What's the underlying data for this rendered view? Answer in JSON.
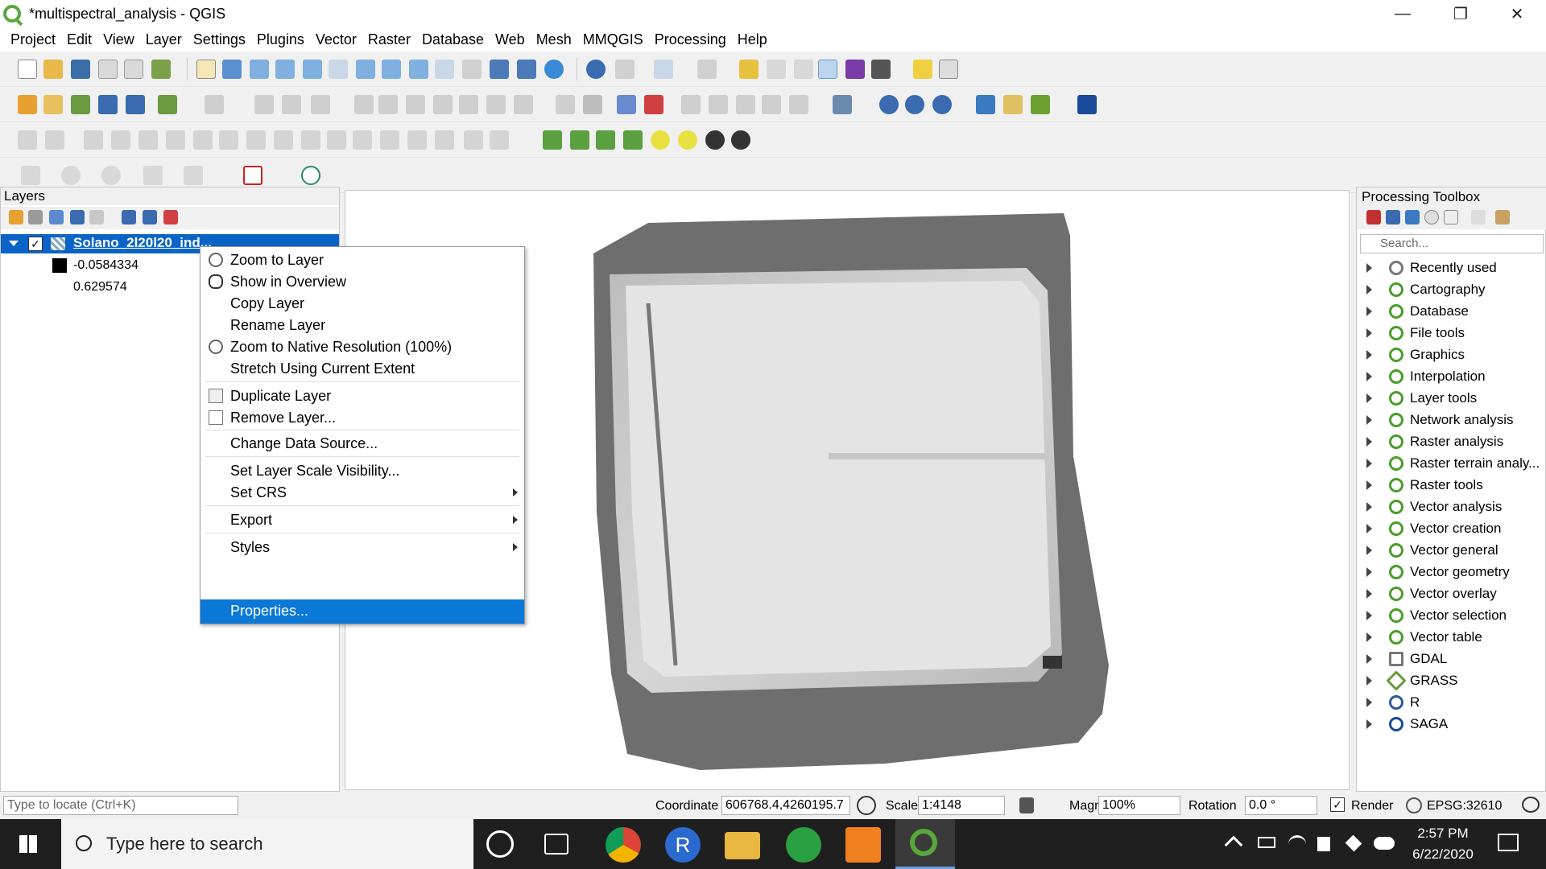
{
  "window": {
    "title": "*multispectral_analysis - QGIS"
  },
  "menubar": {
    "items": [
      "Project",
      "Edit",
      "View",
      "Layer",
      "Settings",
      "Plugins",
      "Vector",
      "Raster",
      "Database",
      "Web",
      "Mesh",
      "MMQGIS",
      "Processing",
      "Help"
    ]
  },
  "layers_panel": {
    "title": "Layers",
    "layer_name": "Solano_2l20l20_ind...",
    "legend_min": "-0.0584334",
    "legend_max": "0.629574"
  },
  "context_menu": {
    "items": [
      "Zoom to Layer",
      "Show in Overview",
      "Copy Layer",
      "Rename Layer",
      "Zoom to Native Resolution (100%)",
      "Stretch Using Current Extent",
      "Duplicate Layer",
      "Remove Layer...",
      "Change Data Source...",
      "Set Layer Scale Visibility...",
      "Set CRS",
      "Export",
      "Styles",
      "Properties..."
    ],
    "selected": "Properties..."
  },
  "toolbox": {
    "title": "Processing Toolbox",
    "search_placeholder": "Search...",
    "items": [
      "Recently used",
      "Cartography",
      "Database",
      "File tools",
      "Graphics",
      "Interpolation",
      "Layer tools",
      "Network analysis",
      "Raster analysis",
      "Raster terrain analy...",
      "Raster tools",
      "Vector analysis",
      "Vector creation",
      "Vector general",
      "Vector geometry",
      "Vector overlay",
      "Vector selection",
      "Vector table",
      "GDAL",
      "GRASS",
      "R",
      "SAGA"
    ]
  },
  "statusbar": {
    "locate_placeholder": "Type to locate (Ctrl+K)",
    "coordinate_label": "Coordinate",
    "coordinate_value": "606768.4,4260195.7",
    "scale_label": "Scale",
    "scale_value": "1:4148",
    "magnifier_label": "Magnifier",
    "magnifier_value": "100%",
    "rotation_label": "Rotation",
    "rotation_value": "0.0 °",
    "render_label": "Render",
    "crs": "EPSG:32610"
  },
  "taskbar": {
    "search_placeholder": "Type here to search",
    "time": "2:57 PM",
    "date": "6/22/2020"
  },
  "colors": {
    "selection": "#0a78d7",
    "qgis_green": "#4a9c2c"
  }
}
